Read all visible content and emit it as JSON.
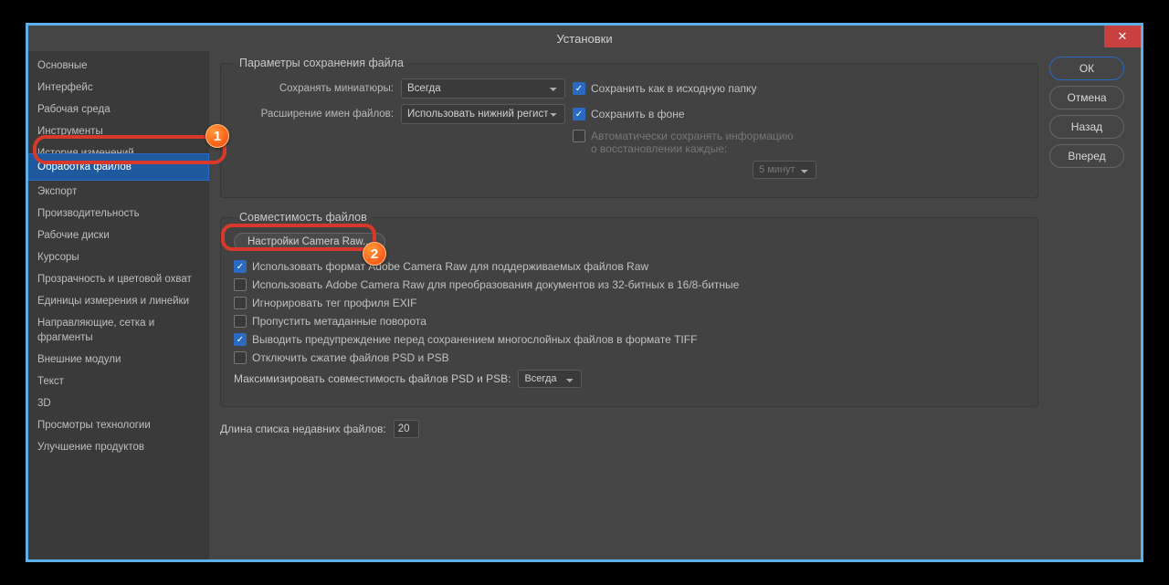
{
  "title": "Установки",
  "buttons": {
    "ok": "ОК",
    "cancel": "Отмена",
    "back": "Назад",
    "forward": "Вперед"
  },
  "sidebar": {
    "items": [
      {
        "label": "Основные"
      },
      {
        "label": "Интерфейс"
      },
      {
        "label": "Рабочая среда"
      },
      {
        "label": "Инструменты"
      },
      {
        "label": "История изменений"
      },
      {
        "label": "Обработка файлов",
        "active": true
      },
      {
        "label": "Экспорт"
      },
      {
        "label": "Производительность"
      },
      {
        "label": "Рабочие диски"
      },
      {
        "label": "Курсоры"
      },
      {
        "label": "Прозрачность и цветовой охват"
      },
      {
        "label": "Единицы измерения и линейки"
      },
      {
        "label": "Направляющие, сетка и фрагменты"
      },
      {
        "label": "Внешние модули"
      },
      {
        "label": "Текст"
      },
      {
        "label": "3D"
      },
      {
        "label": "Просмотры технологии"
      },
      {
        "label": "Улучшение продуктов"
      }
    ]
  },
  "sections": {
    "save": {
      "legend": "Параметры сохранения файла",
      "thumbs_label": "Сохранять миниатюры:",
      "thumbs_value": "Всегда",
      "ext_label": "Расширение имен файлов:",
      "ext_value": "Использовать нижний регистр",
      "save_original": "Сохранить как в исходную папку",
      "save_bg": "Сохранить в фоне",
      "auto_label1": "Автоматически сохранять информацию",
      "auto_label2": "о восстановлении каждые:",
      "auto_interval": "5 минут"
    },
    "compat": {
      "legend": "Совместимость файлов",
      "camera_raw_btn": "Настройки Camera Raw...",
      "c1": "Использовать формат Adobe Camera Raw для поддерживаемых файлов Raw",
      "c2": "Использовать Adobe Camera Raw для преобразования документов из 32-битных в 16/8-битные",
      "c3": "Игнорировать тег профиля EXIF",
      "c4": "Пропустить метаданные поворота",
      "c5": "Выводить предупреждение перед сохранением многослойных файлов в формате TIFF",
      "c6": "Отключить сжатие файлов PSD и PSB",
      "max_label": "Максимизировать совместимость файлов PSD и PSB:",
      "max_value": "Всегда"
    },
    "recent": {
      "label": "Длина списка недавних файлов:",
      "value": "20"
    }
  },
  "badges": {
    "b1": "1",
    "b2": "2"
  }
}
